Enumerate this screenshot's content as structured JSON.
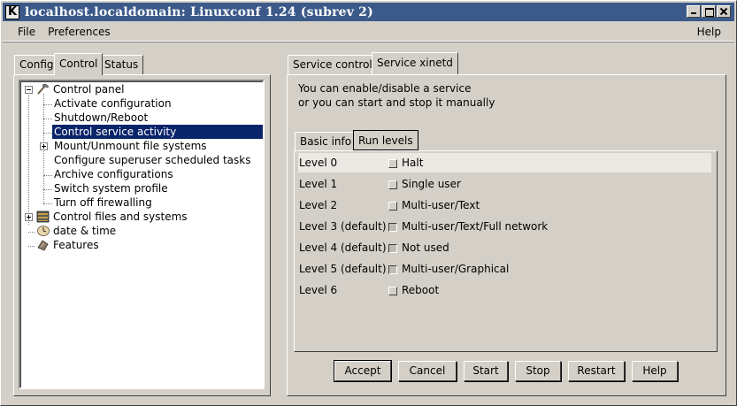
{
  "window": {
    "title": "localhost.localdomain: Linuxconf 1.24 (subrev 2)",
    "app_icon_letter": "K"
  },
  "menubar": {
    "file": "File",
    "preferences": "Preferences",
    "help": "Help"
  },
  "left_tabs": [
    {
      "label": "Config",
      "active": false
    },
    {
      "label": "Control",
      "active": true
    },
    {
      "label": "Status",
      "active": false
    }
  ],
  "tree": {
    "items": [
      {
        "label": "Control panel",
        "icon": "tools-icon",
        "expanded": true
      },
      {
        "label": "Activate configuration"
      },
      {
        "label": "Shutdown/Reboot"
      },
      {
        "label": "Control service activity",
        "selected": true
      },
      {
        "label": "Mount/Unmount file systems",
        "expandable": true
      },
      {
        "label": "Configure superuser scheduled tasks"
      },
      {
        "label": "Archive configurations"
      },
      {
        "label": "Switch system profile"
      },
      {
        "label": "Turn off firewalling"
      },
      {
        "label": "Control files and systems",
        "icon": "file-cabinet-icon",
        "expandable": true
      },
      {
        "label": "date & time",
        "icon": "clock-icon"
      },
      {
        "label": "Features",
        "icon": "features-icon"
      }
    ]
  },
  "right_tabs": [
    {
      "label": "Service control",
      "active": false
    },
    {
      "label": "Service xinetd",
      "active": true
    }
  ],
  "description": {
    "line1": "You can enable/disable a service",
    "line2": "or you can start and stop it manually"
  },
  "inner_tabs": [
    {
      "label": "Basic info",
      "active": false
    },
    {
      "label": "Run levels",
      "active": true
    }
  ],
  "run_levels": [
    {
      "level": "Level 0",
      "label": "Halt",
      "checked": false
    },
    {
      "level": "Level 1",
      "label": "Single user",
      "checked": false
    },
    {
      "level": "Level 2",
      "label": "Multi-user/Text",
      "checked": false
    },
    {
      "level": "Level 3 (default)",
      "label": "Multi-user/Text/Full network",
      "checked": true
    },
    {
      "level": "Level 4 (default)",
      "label": "Not used",
      "checked": true
    },
    {
      "level": "Level 5 (default)",
      "label": "Multi-user/Graphical",
      "checked": true
    },
    {
      "level": "Level 6",
      "label": "Reboot",
      "checked": false
    }
  ],
  "buttons": {
    "accept": "Accept",
    "cancel": "Cancel",
    "start": "Start",
    "stop": "Stop",
    "restart": "Restart",
    "help": "Help"
  }
}
